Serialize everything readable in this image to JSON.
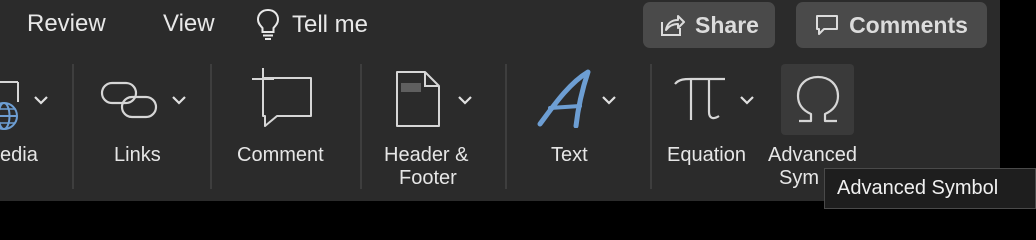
{
  "tabs": {
    "review": "Review",
    "view": "View",
    "tell_me": "Tell me"
  },
  "toolbar": {
    "share_label": "Share",
    "comments_label": "Comments"
  },
  "ribbon": {
    "media_label": "edia",
    "links_label": "Links",
    "comment_label": "Comment",
    "header_footer_line1": "Header &",
    "header_footer_line2": "Footer",
    "text_label": "Text",
    "equation_label": "Equation",
    "advanced_symbol_line1": "Advanced",
    "advanced_symbol_line2": "Sym"
  },
  "tooltip": {
    "text": "Advanced Symbol"
  },
  "icons": {
    "tell_me": "lightbulb-icon",
    "share": "share-icon",
    "comments": "speech-bubble-icon",
    "media": "globe-icon",
    "links": "link-icon",
    "comment": "new-comment-icon",
    "header_footer": "page-header-icon",
    "text": "text-style-icon",
    "equation": "pi-icon",
    "advanced_symbol": "omega-icon"
  },
  "colors": {
    "background": "#2b2b2b",
    "button_fill": "#4a4a4a",
    "accent_blue": "#6d9ed3",
    "tooltip_bg": "#1e1e1e"
  }
}
